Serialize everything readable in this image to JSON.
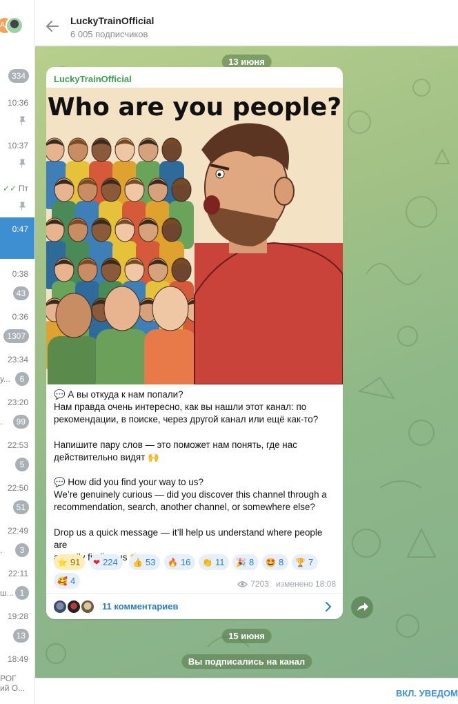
{
  "chat_list": {
    "avatar_initials": "АД",
    "items": [
      {
        "time": "",
        "badge": "334",
        "pinned": false,
        "snippet": ""
      },
      {
        "time": "10:36",
        "badge": "",
        "pinned": true,
        "snippet": ""
      },
      {
        "time": "10:37",
        "badge": "",
        "pinned": true,
        "snippet": ""
      },
      {
        "time": "Пт",
        "badge": "",
        "pinned": true,
        "snippet": "",
        "read": true
      },
      {
        "time": "0:47",
        "badge": "",
        "pinned": false,
        "snippet": "",
        "active": true
      },
      {
        "time": "0:38",
        "badge": "43",
        "pinned": false,
        "snippet": ""
      },
      {
        "time": "0:36",
        "badge": "1307",
        "pinned": false,
        "snippet": ""
      },
      {
        "time": "23:34",
        "badge": "6",
        "pinned": false,
        "snippet": "у..."
      },
      {
        "time": "23:20",
        "badge": "99",
        "pinned": false,
        "snippet": "."
      },
      {
        "time": "22:53",
        "badge": "5",
        "pinned": false,
        "snippet": ""
      },
      {
        "time": "22:50",
        "badge": "51",
        "pinned": false,
        "snippet": ""
      },
      {
        "time": "22:49",
        "badge": "3",
        "pinned": false,
        "snippet": "."
      },
      {
        "time": "22:11",
        "badge": "1",
        "pinned": false,
        "snippet": "ш..."
      },
      {
        "time": "19:28",
        "badge": "13",
        "pinned": false,
        "snippet": ""
      },
      {
        "time": "18:49",
        "badge": "",
        "pinned": false,
        "snippet": "РОГ"
      }
    ],
    "last_snippet": "ий О..."
  },
  "header": {
    "title": "LuckyTrainOfficial",
    "subtitle": "6 005 подписчиков"
  },
  "date_1": "13 июня",
  "post": {
    "channel": "LuckyTrainOfficial",
    "image_title": "Who are you people?",
    "paragraphs": [
      "💬 А вы откуда к нам попали?\nНам правда очень интересно, как вы нашли этот канал: по\nрекомендации, в поиске, через другой канал или ещё как-то?",
      "Напишите пару слов — это поможет нам понять, где нас\nдействительно видят 🙌",
      "💬 How did you find your way to us?\nWe’re genuinely curious — did you discover this channel through a\nrecommendation, search, another channel, or somewhere else?",
      "Drop us a quick message — it’ll help us understand where people are\nactually finding us 🙌"
    ],
    "reactions": [
      {
        "icon": "⭐",
        "count": "91",
        "mine": true
      },
      {
        "icon": "❤",
        "count": "224"
      },
      {
        "icon": "👍",
        "count": "53"
      },
      {
        "icon": "🔥",
        "count": "16"
      },
      {
        "icon": "👏",
        "count": "11"
      },
      {
        "icon": "🎉",
        "count": "8"
      },
      {
        "icon": "🤩",
        "count": "8"
      },
      {
        "icon": "🏆",
        "count": "7"
      },
      {
        "icon": "🥰",
        "count": "4"
      }
    ],
    "views": "7203",
    "edited": "изменено 18:08",
    "comments_label": "11 комментариев"
  },
  "date_2": "15 июня",
  "service_message": "Вы подписались на канал",
  "bottom_action": "ВКЛ. УВЕДОМ",
  "colors": {
    "accent": "#2b7cc5",
    "channel_name": "#3a9d4f",
    "active_chat": "#3d8fd1",
    "badge": "#a9b0b6"
  }
}
